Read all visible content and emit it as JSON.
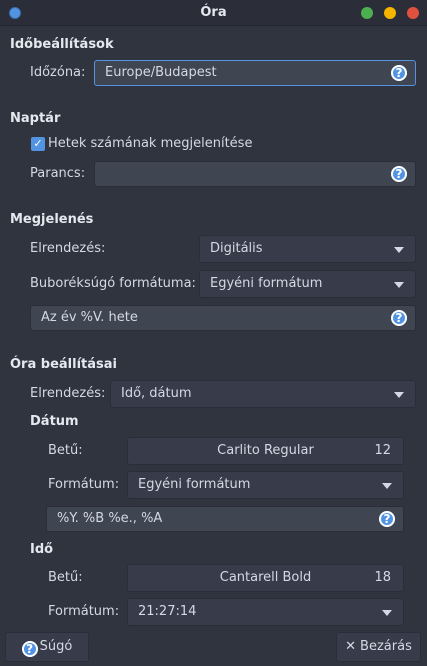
{
  "window": {
    "title": "Óra"
  },
  "time_settings": {
    "heading": "Időbeállítások",
    "timezone_label": "Időzóna:",
    "timezone_value": "Europe/Budapest"
  },
  "calendar": {
    "heading": "Naptár",
    "week_numbers_label": "Hetek számának megjelenítése",
    "week_numbers_checked": true,
    "command_label": "Parancs:",
    "command_value": ""
  },
  "appearance": {
    "heading": "Megjelenés",
    "layout_label": "Elrendezés:",
    "layout_value": "Digitális",
    "tooltip_format_label": "Buboréksúgó formátuma:",
    "tooltip_format_value": "Egyéni formátum",
    "tooltip_custom_value": "Az év %V. hete"
  },
  "clock_settings": {
    "heading": "Óra beállításai",
    "layout_label": "Elrendezés:",
    "layout_value": "Idő, dátum",
    "date": {
      "heading": "Dátum",
      "font_label": "Betű:",
      "font_name": "Carlito Regular",
      "font_size": "12",
      "format_label": "Formátum:",
      "format_value": "Egyéni formátum",
      "custom_format": "%Y. %B %e., %A"
    },
    "time": {
      "heading": "Idő",
      "font_label": "Betű:",
      "font_name": "Cantarell Bold",
      "font_size": "18",
      "format_label": "Formátum:",
      "format_value": "21:27:14"
    }
  },
  "buttons": {
    "help_label": "Súgó",
    "close_label": "Bezárás"
  }
}
